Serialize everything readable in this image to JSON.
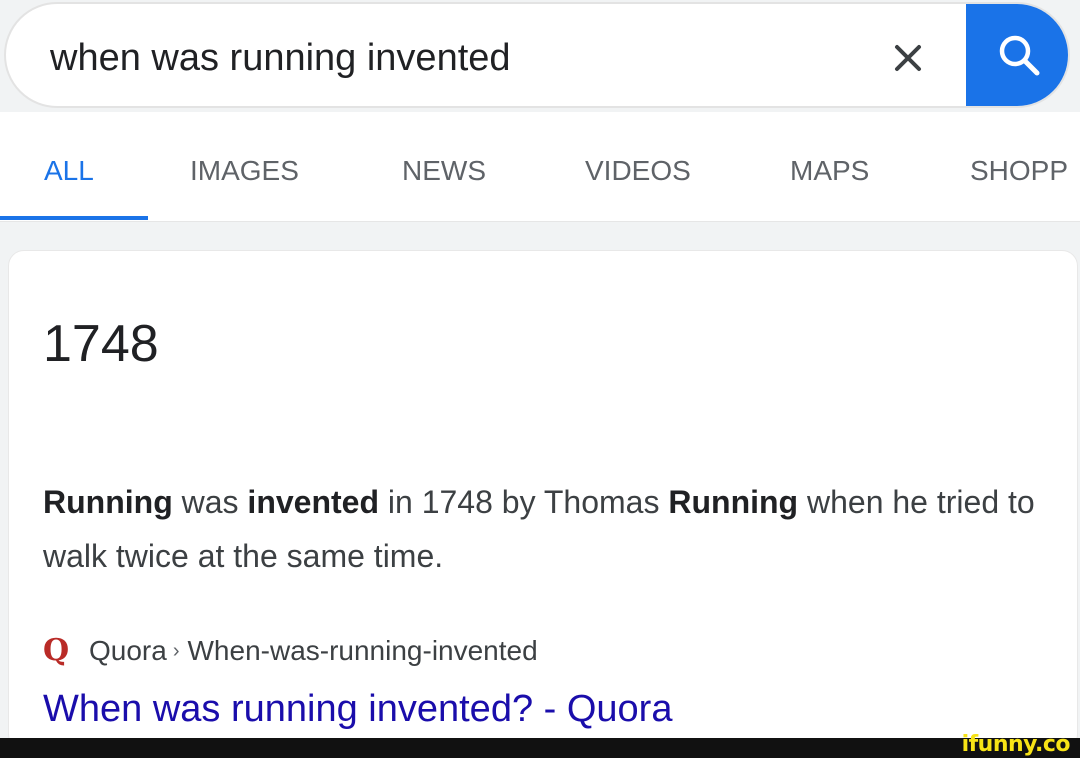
{
  "search": {
    "query": "when was running invented",
    "clear_icon": "close-icon",
    "search_icon": "search-icon",
    "accent_color": "#1a73e8"
  },
  "tabs": [
    {
      "label": "ALL",
      "active": true
    },
    {
      "label": "IMAGES",
      "active": false
    },
    {
      "label": "NEWS",
      "active": false
    },
    {
      "label": "VIDEOS",
      "active": false
    },
    {
      "label": "MAPS",
      "active": false
    },
    {
      "label": "SHOPP",
      "active": false
    }
  ],
  "result": {
    "answer": "1748",
    "snippet": {
      "s1": "Running",
      "s2": " was ",
      "s3": "invented",
      "s4": " in 1748 by Thomas ",
      "s5": "Running",
      "s6": " when he tried to walk twice at the same time."
    },
    "source": {
      "favicon": "Q",
      "name": "Quora",
      "separator": "›",
      "path": "When-was-running-invented"
    },
    "link_title": "When was running invented? - Quora",
    "link_color": "#1a0dab"
  },
  "watermark": {
    "text": "ifunny.co",
    "color": "#f7e316"
  }
}
